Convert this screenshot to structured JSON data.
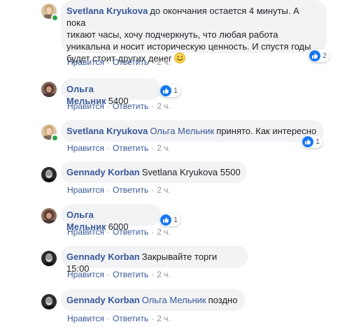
{
  "colors": {
    "link": "#385898",
    "bubble": "#f2f3f5",
    "text": "#1c1e21",
    "meta": "#90949c",
    "like_blue": "#1877f2",
    "online": "#31a24c"
  },
  "actions": {
    "like_label": "Нравится",
    "reply_label": "Ответить",
    "separator": "·"
  },
  "comments": [
    {
      "author": "Svetlana Kryukova",
      "mention": "",
      "text_lines": [
        "до окончания остается 4 минуты. А пока",
        "тикают часы, хочу подчеркнуть, что любая работа",
        "уникальна и носит историческую ценность. И спустя годы",
        "будет стоит других денег"
      ],
      "emoji": "smile-emoji",
      "reaction": {
        "icon": "like-icon",
        "count": "2"
      },
      "time": "2 ч."
    },
    {
      "author": "Ольга Мельник",
      "mention": "",
      "text": "5400",
      "reaction": {
        "icon": "like-icon",
        "count": "1"
      },
      "time": "2 ч."
    },
    {
      "author": "Svetlana Kryukova",
      "mention": "Ольга Мельник",
      "text": "принято. Как интересно",
      "reaction": {
        "icon": "like-icon",
        "count": "1"
      },
      "time": "2 ч."
    },
    {
      "author": "Gennady Korban",
      "mention": "",
      "text": "Svetlana Kryukova 5500",
      "time": "2 ч."
    },
    {
      "author": "Ольга Мельник",
      "mention": "",
      "text": "6000",
      "reaction": {
        "icon": "like-icon",
        "count": "1"
      },
      "time": "2 ч."
    },
    {
      "author": "Gennady Korban",
      "mention": "",
      "text": "Закрывайте торги 15:00",
      "time": "2 ч."
    },
    {
      "author": "Gennady Korban",
      "mention": "Ольга Мельник",
      "text": "поздно",
      "time": "2 ч."
    }
  ]
}
